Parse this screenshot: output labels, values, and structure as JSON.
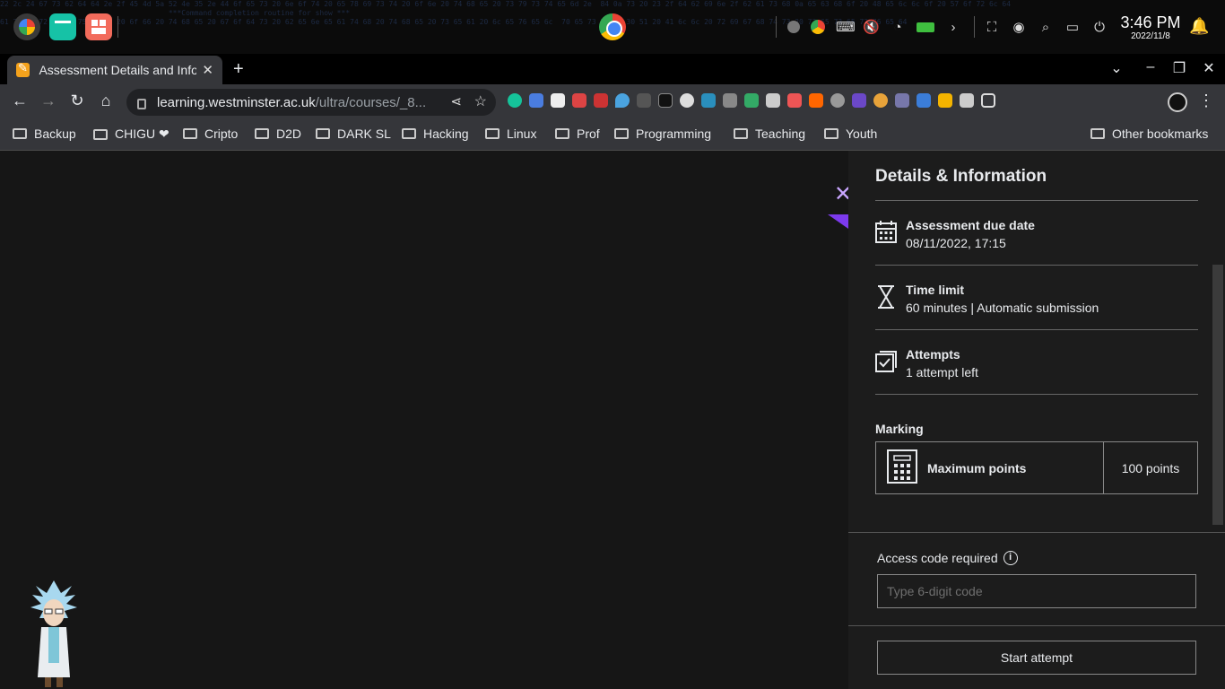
{
  "os": {
    "clock_time": "3:46 PM",
    "clock_date": "2022/11/8",
    "terminal_noise": "22 2c 24 67 73 62 64 64 2e 2f 45 4d 5a 52 4e 35 2e 44 6f 65 73 20 6e 6f 74 20 65 78 69 73 74 20 6f 6e 20 74 68 65 20 73 79 73 74 65 6d 2e  84 0a 73 20 23 2f 64 62 69 6e 2f 62 61 73 68 0a 65 63 68 6f 20 48 65 6c 6c 6f 20 57 6f 72 6c 64\n                                       ***Command completion routine for show ***\n61 73 20 72 65 74 75 72 6e 20 6f 66 20 74 68 65 20 67 6f 64 73 20 62 65 6e 65 61 74 68 20 74 68 65 20 73 65 61 20 6c 65 76 65 6c  70 65 73 74 20 30 51 20 41 6c 6c 20 72 69 67 68 74 73 20 72 65 73 65 72 76 65 64"
  },
  "browser": {
    "tab_title": "Assessment Details and Information",
    "url_host": "learning.westminster.ac.uk",
    "url_path": "/ultra/courses/_8...",
    "bookmarks": [
      "Backup",
      "CHIGU ❤",
      "Cripto",
      "D2D",
      "DARK SL",
      "Hacking",
      "Linux",
      "Prof",
      "Programming",
      "Teaching",
      "Youth"
    ],
    "other_bookmarks": "Other bookmarks"
  },
  "panel": {
    "title": "Details & Information",
    "due_label": "Assessment due date",
    "due_value": "08/11/2022, 17:15",
    "time_label": "Time limit",
    "time_value": "60 minutes | Automatic submission",
    "attempts_label": "Attempts",
    "attempts_value": "1 attempt left",
    "marking_label": "Marking",
    "max_points_label": "Maximum points",
    "max_points_value": "100 points",
    "access_label": "Access code required",
    "access_placeholder": "Type 6-digit code",
    "start_button": "Start attempt"
  },
  "colors": {
    "accent_purple": "#7c3aed",
    "close_x": "#c9a6ff",
    "panel_bg": "#1c1c1c",
    "page_bg": "#161616"
  }
}
